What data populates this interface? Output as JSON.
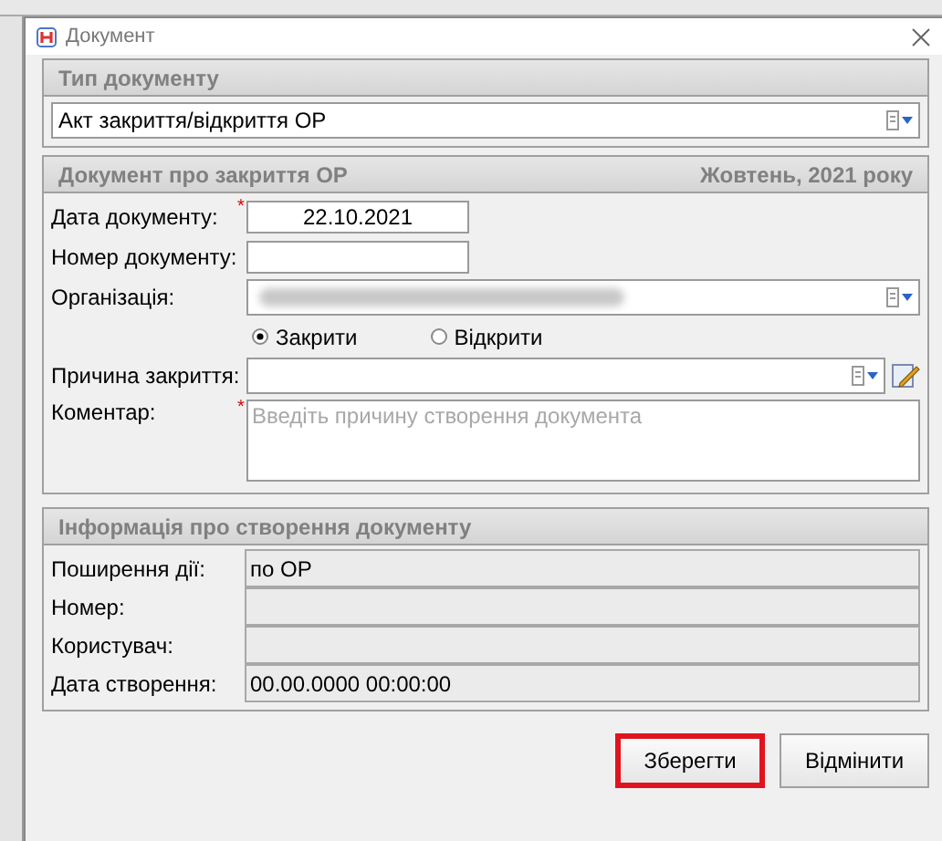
{
  "window": {
    "title": "Документ"
  },
  "doc_type": {
    "title": "Тип документу",
    "value": "Акт закриття/відкриття ОР"
  },
  "document": {
    "title": "Документ про закриття ОР",
    "period": "Жовтень, 2021 року",
    "date": {
      "label": "Дата документу:",
      "value": "22.10.2021",
      "marker": "*"
    },
    "number": {
      "label": "Номер документу:"
    },
    "organization": {
      "label": "Організація:",
      "redacted": true
    },
    "radios": [
      {
        "label": "Закрити",
        "selected": true
      },
      {
        "label": "Відкрити",
        "selected": false
      }
    ],
    "reason": {
      "label": "Причина закриття:"
    },
    "comment": {
      "label": "Коментар:",
      "placeholder": "Введіть причину створення документа",
      "marker": "*"
    }
  },
  "info": {
    "title": "Інформація про створення документу",
    "rows": [
      {
        "label": "Поширення дії:",
        "value": "по ОР"
      },
      {
        "label": "Номер:"
      },
      {
        "label": "Користувач:"
      },
      {
        "label": "Дата створення:",
        "value": "00.00.0000 00:00:00"
      }
    ]
  },
  "buttons": [
    {
      "label": "Зберегти",
      "highlighted": true
    },
    {
      "label": "Відмінити",
      "highlighted": false
    }
  ]
}
